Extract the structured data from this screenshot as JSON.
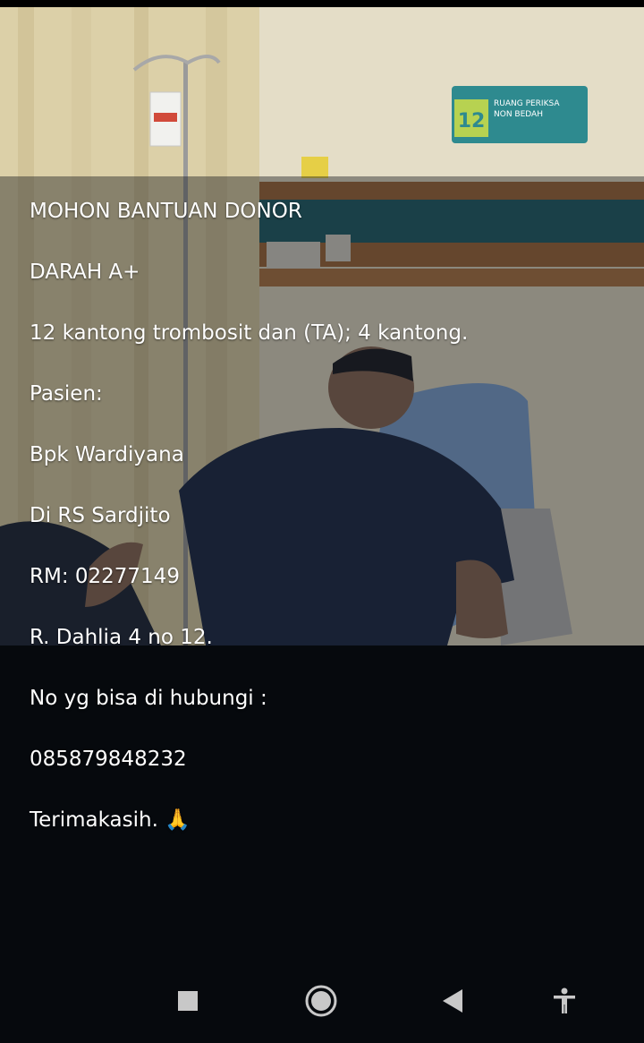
{
  "caption": {
    "lines": [
      "MOHON BANTUAN DONOR",
      "DARAH A+",
      "12 kantong trombosit dan (TA); 4 kantong.",
      "Pasien:",
      "Bpk Wardiyana",
      "Di RS Sardjito",
      "RM: 02277149",
      "R. Dahlia 4 no 12.",
      "No yg bisa di hubungi :",
      "085879848232",
      "Terimakasih. 🙏"
    ]
  },
  "photo": {
    "room_sign_number": "12",
    "room_sign_line1": "RUANG PERIKSA",
    "room_sign_line2": "NON BEDAH"
  },
  "navbar": {
    "recents_icon": "square-stop-icon",
    "home_icon": "circle-home-icon",
    "back_icon": "triangle-back-icon",
    "accessibility_icon": "accessibility-person-icon"
  },
  "colors": {
    "background": "#06090d",
    "caption_text": "#ffffff",
    "sign_background": "#2e8a8f",
    "sign_number": "#c7d94a",
    "nav_icons": "#c8c8c8"
  }
}
